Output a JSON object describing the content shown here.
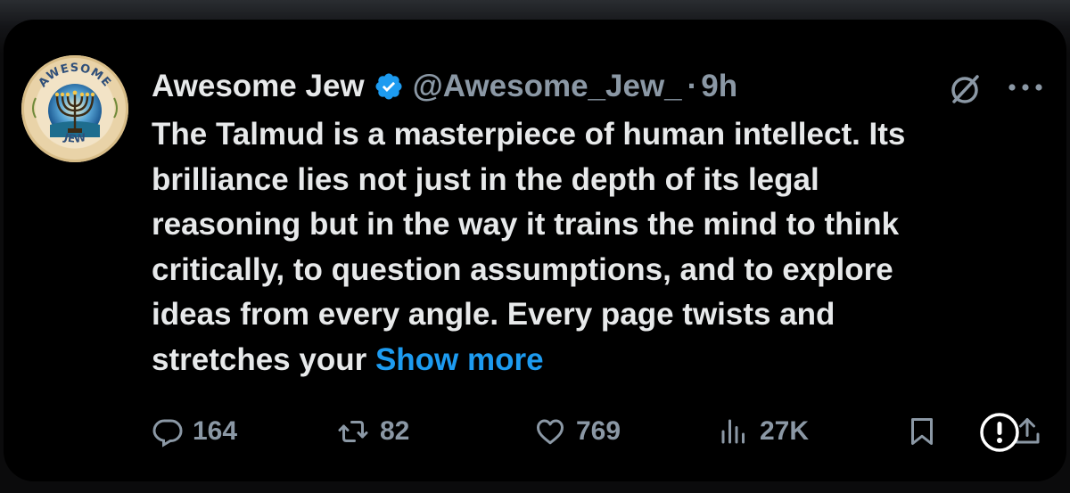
{
  "tweet": {
    "author_name": "Awesome Jew",
    "handle": "@Awesome_Jew_",
    "separator": "·",
    "time": "9h",
    "body_lines": [
      "The Talmud is a masterpiece of human intellect. Its",
      "brilliance lies not just in the depth of its legal",
      "reasoning but in the way it trains the mind to think",
      "critically, to question assumptions, and to explore",
      "ideas from every angle. Every page twists and"
    ],
    "last_line_text": "stretches your ",
    "show_more": "Show more",
    "avatar": {
      "top_text": "AWESOME",
      "bottom_text": "JEW"
    }
  },
  "actions": {
    "replies": "164",
    "reposts": "82",
    "likes": "769",
    "views": "27K"
  },
  "icons": {
    "verified": "verified-badge-icon",
    "grok": "grok-icon",
    "more": "more-options-icon",
    "reply": "reply-icon",
    "repost": "repost-icon",
    "like": "heart-icon",
    "views": "views-icon",
    "bookmark": "bookmark-icon",
    "share": "share-icon",
    "report": "alert-icon"
  },
  "colors": {
    "background": "#000000",
    "text_primary": "#e7e9ea",
    "text_secondary": "#8b98a5",
    "accent": "#1d9bf0"
  }
}
